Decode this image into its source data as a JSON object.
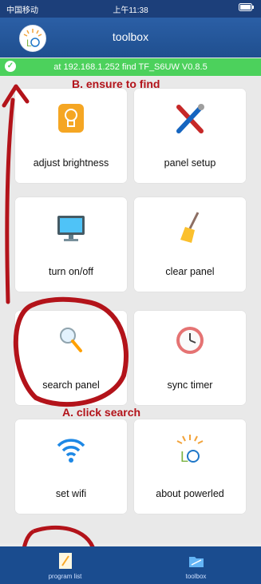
{
  "status": {
    "carrier": "中国移动",
    "time": "上午11:38"
  },
  "nav": {
    "title": "toolbox"
  },
  "banner": {
    "text": "at 192.168.1.252 find TF_S6UW V0.8.5"
  },
  "tiles": [
    {
      "label": "adjust brightness",
      "icon": "lightbulb-icon"
    },
    {
      "label": "panel setup",
      "icon": "tools-icon"
    },
    {
      "label": "turn on/off",
      "icon": "monitor-icon"
    },
    {
      "label": "clear panel",
      "icon": "broom-icon"
    },
    {
      "label": "search panel",
      "icon": "magnifier-icon"
    },
    {
      "label": "sync timer",
      "icon": "clock-icon"
    },
    {
      "label": "set wifi",
      "icon": "wifi-icon"
    },
    {
      "label": "about powerled",
      "icon": "led-logo-icon"
    }
  ],
  "tabs": [
    {
      "label": "program list",
      "icon": "notepad-icon"
    },
    {
      "label": "toolbox",
      "icon": "folder-icon"
    }
  ],
  "annotations": {
    "a": "A. click search",
    "b": "B. ensure to find"
  },
  "colors": {
    "nav": "#1f4f8f",
    "banner": "#4cd15c",
    "annotation": "#b3131a"
  }
}
